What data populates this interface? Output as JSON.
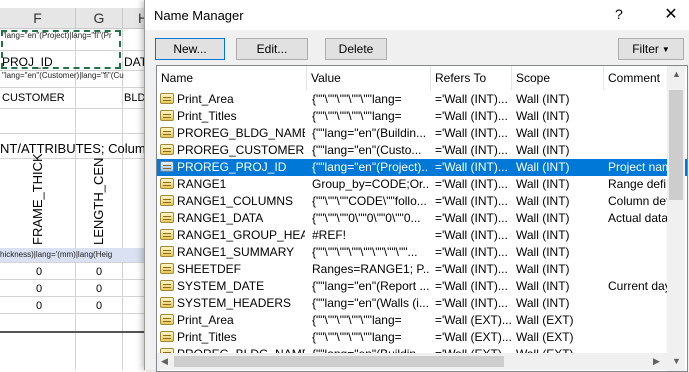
{
  "spreadsheet": {
    "col_f": "F",
    "col_g": "G",
    "col_h": "H",
    "row1_text": "\"lang=\"en\"(Project)|lang=\"fi\"(Pr",
    "proj_id": "PROJ_ID",
    "dat": "DAT",
    "row3_text": "\"lang=\"en\"(Customer)|lang=\"fi\"(Cu",
    "customer": "CUSTOMER",
    "bld": "BLD",
    "attributes": "NT/ATTRIBUTES;  Column",
    "frame_thick": "FRAME_THICK",
    "length_cen": "LENGTH_CEN",
    "thickness_row": "hickness)|lang='(mm)|lang(Heig",
    "zero": "0"
  },
  "dialog": {
    "title": "Name Manager",
    "help": "?",
    "close": "✕",
    "buttons": {
      "new": "New...",
      "edit": "Edit...",
      "delete": "Delete",
      "filter": "Filter"
    },
    "columns": [
      "Name",
      "Value",
      "Refers To",
      "Scope",
      "Comment"
    ],
    "rows": [
      {
        "name": "Print_Area",
        "value": "{\"\"\\\"\"\\\"\"\\\"\"\\\"\"lang=",
        "refers": "='Wall (INT)...",
        "scope": "Wall (INT)",
        "comment": ""
      },
      {
        "name": "Print_Titles",
        "value": "{\"\"\\\"\"\\\"\"\\\"\"\\\"\"lang=",
        "refers": "='Wall (INT)...",
        "scope": "Wall (INT)",
        "comment": ""
      },
      {
        "name": "PROREG_BLDG_NAME",
        "value": "{\"\"lang=\"en\"(Buildin...",
        "refers": "='Wall (INT)...",
        "scope": "Wall (INT)",
        "comment": ""
      },
      {
        "name": "PROREG_CUSTOMER",
        "value": "{\"\"lang=\"en\"(Custo...",
        "refers": "='Wall (INT)...",
        "scope": "Wall (INT)",
        "comment": ""
      },
      {
        "name": "PROREG_PROJ_ID",
        "value": "{\"\"lang=\"en\"(Project)...",
        "refers": "='Wall (INT)...",
        "scope": "Wall (INT)",
        "comment": "Project name"
      },
      {
        "name": "RANGE1",
        "value": "Group_by=CODE;Or...",
        "refers": "='Wall (INT)...",
        "scope": "Wall (INT)",
        "comment": "Range defi"
      },
      {
        "name": "RANGE1_COLUMNS",
        "value": "{\"\"\\\"\"\\\"\"CODE\\\"\"follo...",
        "refers": "='Wall (INT)...",
        "scope": "Wall (INT)",
        "comment": "Column defi"
      },
      {
        "name": "RANGE1_DATA",
        "value": "{\"\"\\\"\"\\\"\"0\\\"\"0\\\"\"0\\\"\"0...",
        "refers": "='Wall (INT)...",
        "scope": "Wall (INT)",
        "comment": "Actual data r"
      },
      {
        "name": "RANGE1_GROUP_HEA...",
        "value": "#REF!",
        "refers": "='Wall (INT)...",
        "scope": "Wall (INT)",
        "comment": ""
      },
      {
        "name": "RANGE1_SUMMARY",
        "value": "{\"\"\\\"\"\\\"\"\\\"\"\\\"\"\\\"\"\\\"\"\\\"\"...",
        "refers": "='Wall (INT)...",
        "scope": "Wall (INT)",
        "comment": ""
      },
      {
        "name": "SHEETDEF",
        "value": "Ranges=RANGE1; P...",
        "refers": "='Wall (INT)...",
        "scope": "Wall (INT)",
        "comment": ""
      },
      {
        "name": "SYSTEM_DATE",
        "value": "{\"\"lang=\"en\"(Report ...",
        "refers": "='Wall (INT)...",
        "scope": "Wall (INT)",
        "comment": "Current day"
      },
      {
        "name": "SYSTEM_HEADERS",
        "value": "{\"\"lang=\"en\"(Walls (i...",
        "refers": "='Wall (INT)...",
        "scope": "Wall (INT)",
        "comment": ""
      },
      {
        "name": "Print_Area",
        "value": "{\"\"\\\"\"\\\"\"\\\"\"\\\"\"lang=",
        "refers": "='Wall (EXT)...",
        "scope": "Wall (EXT)",
        "comment": ""
      },
      {
        "name": "Print_Titles",
        "value": "{\"\"\\\"\"\\\"\"\\\"\"\\\"\"lang=",
        "refers": "='Wall (EXT)...",
        "scope": "Wall (EXT)",
        "comment": ""
      },
      {
        "name": "PROREG_BLDG_NAME",
        "value": "{\"\"lang=\"en\"(Buildin...",
        "refers": "='Wall (EXT)...",
        "scope": "Wall (EXT)",
        "comment": ""
      }
    ],
    "selected_row": 4
  },
  "colors": {
    "accent": "#0078d7",
    "dialog_bg": "#f0f0f0",
    "excel_green": "#217346"
  },
  "icons": {
    "name_item": "name-range-icon",
    "filter": "dropdown-triangle-icon"
  }
}
